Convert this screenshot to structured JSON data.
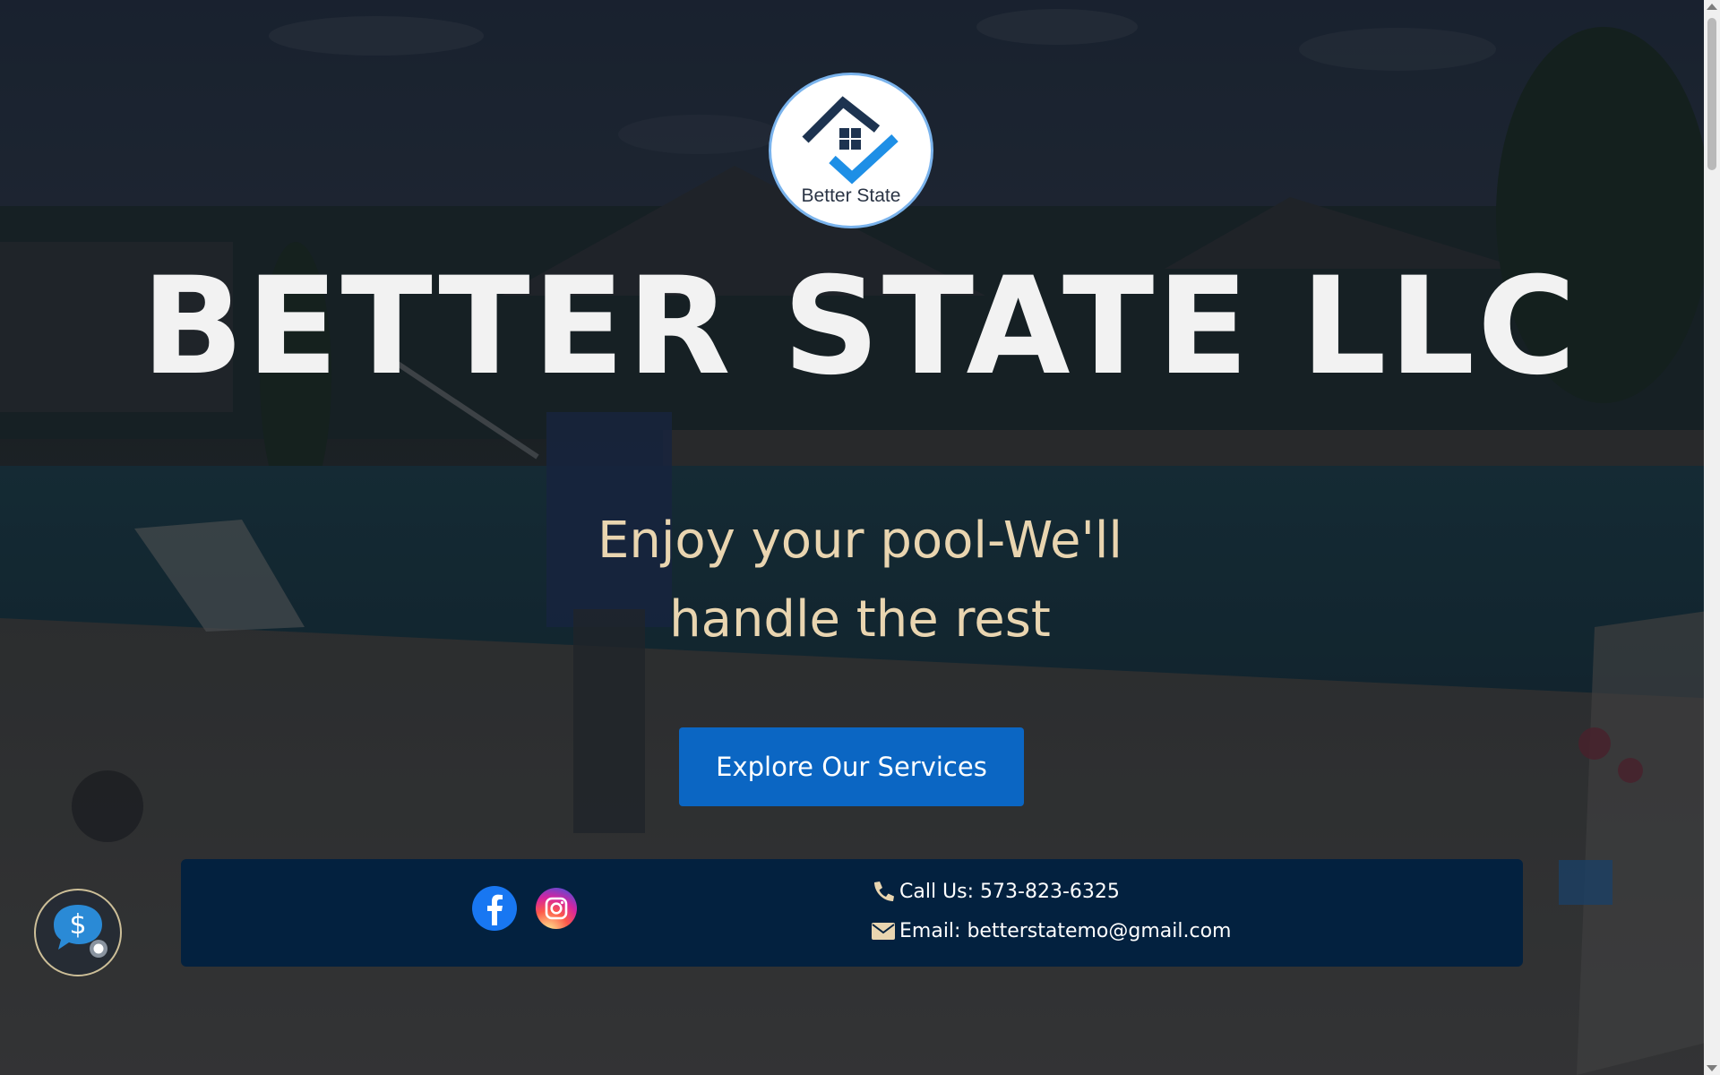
{
  "logo": {
    "text": "Better State"
  },
  "hero": {
    "title": "BETTER STATE LLC",
    "tagline_line1": "Enjoy your pool-We'll",
    "tagline_line2": "handle the rest",
    "cta_label": "Explore Our Services"
  },
  "contact": {
    "phone_label": "Call Us: 573-823-6325",
    "email_label": "Email: betterstatemo@gmail.com",
    "social": [
      "facebook-icon",
      "instagram-icon"
    ]
  },
  "widgets": {
    "chat_icon": "dollar-chat-icon"
  },
  "colors": {
    "cta": "#0b66c3",
    "contact_bar": "#03213f",
    "tagline": "#e9d5b0",
    "logo_blue": "#1e8fe6",
    "logo_navy": "#1d3350"
  }
}
